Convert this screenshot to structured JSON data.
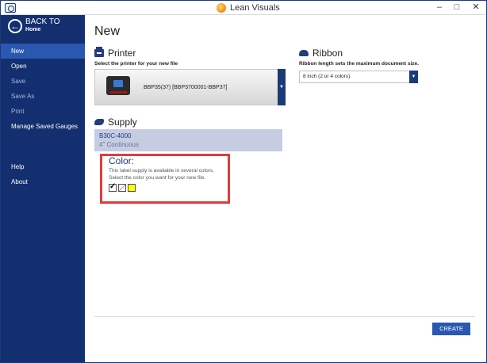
{
  "window": {
    "title": "Lean Visuals",
    "minimize": "–",
    "maximize": "□",
    "close": "✕"
  },
  "sidebar": {
    "back_title": "BACK TO",
    "back_sub": "Home",
    "back_glyph": "←",
    "items": [
      {
        "label": "New",
        "state": "active"
      },
      {
        "label": "Open",
        "state": "normal"
      },
      {
        "label": "Save",
        "state": "disabled"
      },
      {
        "label": "Save As",
        "state": "disabled"
      },
      {
        "label": "Print",
        "state": "disabled"
      },
      {
        "label": "Manage Saved Gauges",
        "state": "normal"
      },
      {
        "label": "Help",
        "state": "normal"
      },
      {
        "label": "About",
        "state": "normal"
      }
    ]
  },
  "main": {
    "page_title": "New",
    "printer": {
      "heading": "Printer",
      "subtitle": "Select the printer for your new file",
      "selected": "BBP35(37) [BBP3700001-BBP37]",
      "arrow": "▼"
    },
    "ribbon": {
      "heading": "Ribbon",
      "subtitle": "Ribbon length sets the maximum document size.",
      "selected": "8 inch (2 or 4 colors)",
      "arrow": "▼"
    },
    "supply": {
      "heading": "Supply",
      "name": "B30C-4000",
      "description": "4\" Continuous"
    },
    "color": {
      "heading": "Color:",
      "line1": "This label supply is available in several colors.",
      "line2": "Select the color you want for your new file."
    },
    "create_label": "CREATE"
  },
  "colors": {
    "sidebar": "#132f6f",
    "accent": "#2a58b0",
    "highlight": "#e23b3b"
  }
}
